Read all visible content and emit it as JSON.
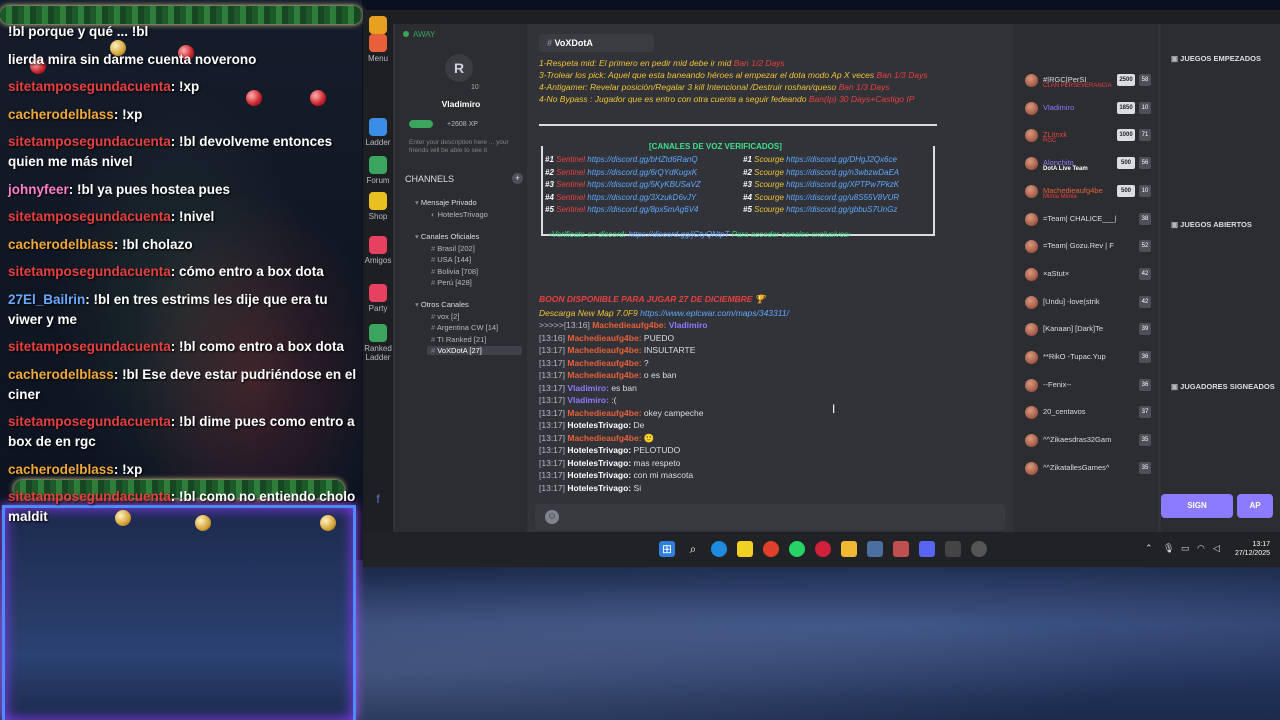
{
  "chat_overlay": {
    "lines": [
      {
        "user": "",
        "text": "!bl porque y qué ... !bl"
      },
      {
        "user": "",
        "text": "lierda mira sin darme cuenta noverono"
      },
      {
        "user": "sitetamposegundacuenta",
        "text": "!xp"
      },
      {
        "user": "cacherodelblass",
        "text": "!xp"
      },
      {
        "user": "sitetamposegundacuenta",
        "text": "!bl devolveme entonces quien me más nivel"
      },
      {
        "user": "johnyfeer",
        "text": "!bl ya pues hostea pues"
      },
      {
        "user": "sitetamposegundacuenta",
        "text": "!nivel"
      },
      {
        "user": "cacherodelblass",
        "text": "!bl cholazo"
      },
      {
        "user": "sitetamposegundacuenta",
        "text": "cómo entro a box dota"
      },
      {
        "user": "27El_Bailrin",
        "text": "!bl en tres estrims les dije que era tu viwer y me"
      },
      {
        "user": "sitetamposegundacuenta",
        "text": "!bl como entro a box dota"
      },
      {
        "user": "cacherodelblass",
        "text": "!bl Ese deve estar pudriéndose en el ciner"
      },
      {
        "user": "sitetamposegundacuenta",
        "text": "!bl dime pues como entro a box de en rgc"
      },
      {
        "user": "cacherodelblass",
        "text": "!xp"
      },
      {
        "user": "sitetamposegundacuenta",
        "text": "!bl como no entiendo cholo maldit"
      }
    ]
  },
  "app": {
    "status": "AWAY",
    "rail": [
      {
        "label": "Menu",
        "icon": "gear-icon"
      },
      {
        "label": "Ladder",
        "icon": "chart-icon"
      },
      {
        "label": "Forum",
        "icon": "forum-icon"
      },
      {
        "label": "Shop",
        "icon": "shop-icon"
      },
      {
        "label": "Amigos",
        "icon": "friends-icon"
      },
      {
        "label": "Party",
        "icon": "party-icon"
      },
      {
        "label": "Ranked Ladder",
        "icon": "ranked-icon"
      }
    ],
    "profile": {
      "logo": "R",
      "level": "10",
      "username": "Vladimiro",
      "xp": "+2608 XP",
      "description": "Enter your description here ... your friends will be able to see it"
    },
    "channels_header": "CHANNELS",
    "categories": [
      {
        "name": "Mensaje Privado",
        "items": [
          "HotelesTrivago"
        ]
      },
      {
        "name": "Canales Oficiales",
        "items": [
          "Brasil [202]",
          "USA [144]",
          "Bolivia [708]",
          "Perú [428]"
        ]
      },
      {
        "name": "Otros Canales",
        "items": [
          "vox [2]",
          "Argentina CW [14]",
          "TI Ranked [21]",
          "VoXDotA [27]"
        ]
      }
    ],
    "channel_title": "VoXDotA",
    "rules": [
      {
        "text": "1-Respeta mid: El primero en pedir mid debe ir mid",
        "tag": "Ban 1/2 Days"
      },
      {
        "text": "3-Trolear los pick: Aquel que esta baneando héroes al empezar el dota modo Ap X veces",
        "tag": "Ban 1/3 Days"
      },
      {
        "text": "4-Antigamer: Revelar posición/Regalar 3 kill Intencional /Destruir roshan/queso",
        "tag": "Ban 1/3 Days"
      },
      {
        "text": "4-No Bypass : Jugador que es entro con otra cuenta a seguir fedeando",
        "tag": "Ban(Ip) 30 Days+Castigo IP"
      }
    ],
    "voice_title": "[CANALES DE VOZ VERIFICADOS]",
    "voice_left": [
      {
        "n": "#1",
        "name": "Sentinel",
        "link": "https://discord.gg/bHZtd6RanQ"
      },
      {
        "n": "#2",
        "name": "Sentinel",
        "link": "https://discord.gg/6rQYdKugxK"
      },
      {
        "n": "#3",
        "name": "Sentinel",
        "link": "https://discord.gg/5KyKBUSaVZ"
      },
      {
        "n": "#4",
        "name": "Sentinel",
        "link": "https://discord.gg/3XzukD6vJY"
      },
      {
        "n": "#5",
        "name": "Sentinel",
        "link": "https://discord.gg/8px5mAg6V4"
      }
    ],
    "voice_right": [
      {
        "n": "#1",
        "name": "Scourge",
        "link": "https://discord.gg/DHgJ2Qx6ce"
      },
      {
        "n": "#2",
        "name": "Scourge",
        "link": "https://discord.gg/n3wbzwDaEA"
      },
      {
        "n": "#3",
        "name": "Scourge",
        "link": "https://discord.gg/XPTPw7PkzK"
      },
      {
        "n": "#4",
        "name": "Scourge",
        "link": "https://discord.gg/u8S55V8VUR"
      },
      {
        "n": "#5",
        "name": "Scourge",
        "link": "https://discord.gg/gbbuS7UnGz"
      }
    ],
    "verify": {
      "pre": "•Verificate en discord:",
      "link": "https://discord.gg/jGtyQNtpT",
      "post": "Para acceder canales exclusivos•"
    },
    "announce": "BOON DISPONIBLE PARA JUGAR 27 DE DICIEMBRE",
    "download": {
      "text": "Descarga New Map 7.0F9",
      "link": "https://www.eplcwar.com/maps/343311/"
    },
    "messages": [
      {
        "ts": ">>>>>[13:16]",
        "user": "Machedieaufg4be:",
        "text": "Vladimiro",
        "ucls": "u-mach",
        "tcls": "u-vlad"
      },
      {
        "ts": "[13:16]",
        "user": "Machedieaufg4be:",
        "text": "PUEDO",
        "ucls": "u-mach",
        "tcls": ""
      },
      {
        "ts": "[13:17]",
        "user": "Machedieaufg4be:",
        "text": "INSULTARTE",
        "ucls": "u-mach",
        "tcls": ""
      },
      {
        "ts": "[13:17]",
        "user": "Machedieaufg4be:",
        "text": "?",
        "ucls": "u-mach",
        "tcls": ""
      },
      {
        "ts": "[13:17]",
        "user": "Machedieaufg4be:",
        "text": "o es ban",
        "ucls": "u-mach",
        "tcls": ""
      },
      {
        "ts": "[13:17]",
        "user": "Vladimiro:",
        "text": "es ban",
        "ucls": "u-vlad",
        "tcls": ""
      },
      {
        "ts": "[13:17]",
        "user": "Vladimiro:",
        "text": ":(",
        "ucls": "u-vlad",
        "tcls": ""
      },
      {
        "ts": "[13:17]",
        "user": "Machedieaufg4be:",
        "text": "okey campeche",
        "ucls": "u-mach",
        "tcls": ""
      },
      {
        "ts": "[13:17]",
        "user": "HotelesTrivago:",
        "text": "De",
        "ucls": "u-hot",
        "tcls": ""
      },
      {
        "ts": "[13:17]",
        "user": "Machedieaufg4be:",
        "text": "🙂",
        "ucls": "u-mach",
        "tcls": ""
      },
      {
        "ts": "[13:17]",
        "user": "HotelesTrivago:",
        "text": "PELOTUDO",
        "ucls": "u-hot",
        "tcls": ""
      },
      {
        "ts": "[13:17]",
        "user": "HotelesTrivago:",
        "text": "mas respeto",
        "ucls": "u-hot",
        "tcls": ""
      },
      {
        "ts": "[13:17]",
        "user": "HotelesTrivago:",
        "text": "con mi mascota",
        "ucls": "u-hot",
        "tcls": ""
      },
      {
        "ts": "[13:17]",
        "user": "HotelesTrivago:",
        "text": "Si",
        "ucls": "u-hot",
        "tcls": ""
      }
    ],
    "members": [
      {
        "name": "#|RGC|PerSI",
        "sub": "CLAN PERSEVERANCIA",
        "score": "2500",
        "lvl": "58"
      },
      {
        "name": "Vladimiro",
        "sub": "",
        "score": "1850",
        "lvl": "10"
      },
      {
        "name": "ZLitnxk",
        "sub": "RGC",
        "score": "1000",
        "lvl": "71"
      },
      {
        "name": "Alonchito",
        "sub": "DotA Live Team",
        "score": "500",
        "lvl": "56"
      },
      {
        "name": "Machedieaufg4be",
        "sub": "Mimia Mimia",
        "score": "500",
        "lvl": "10"
      },
      {
        "name": "=Team| CHALICE___|",
        "sub": "",
        "score": "",
        "lvl": "38"
      },
      {
        "name": "=Team| Gozu.Rev | F",
        "sub": "",
        "score": "",
        "lvl": "52"
      },
      {
        "name": "×aStut×",
        "sub": "",
        "score": "",
        "lvl": "42"
      },
      {
        "name": "[Undu] -love(strik",
        "sub": "",
        "score": "",
        "lvl": "42"
      },
      {
        "name": "[Kanaan] [Dark]Te",
        "sub": "",
        "score": "",
        "lvl": "39"
      },
      {
        "name": "**RikO -Tupac.Yup",
        "sub": "",
        "score": "",
        "lvl": "36"
      },
      {
        "name": "--Fenix--",
        "sub": "",
        "score": "",
        "lvl": "36"
      },
      {
        "name": "20_centavos",
        "sub": "",
        "score": "",
        "lvl": "37"
      },
      {
        "name": "^^Zikaesdras32Gam",
        "sub": "",
        "score": "",
        "lvl": "35"
      },
      {
        "name": "^^ZikatallesGames^",
        "sub": "",
        "score": "",
        "lvl": "35"
      }
    ],
    "right_panel": {
      "started": "JUEGOS EMPEZADOS",
      "open": "JUEGOS ABIERTOS",
      "signed": "JUGADORES SIGNEADOS",
      "sign": "SIGN",
      "ap": "AP"
    },
    "taskbar": {
      "time": "13:17",
      "date": "27/12/2025"
    }
  },
  "colors": {
    "accent": "#8b7bff",
    "sentinel": "#e84040",
    "scourge": "#f0c43a",
    "link": "#5fa8ff",
    "online": "#3ba55d"
  }
}
